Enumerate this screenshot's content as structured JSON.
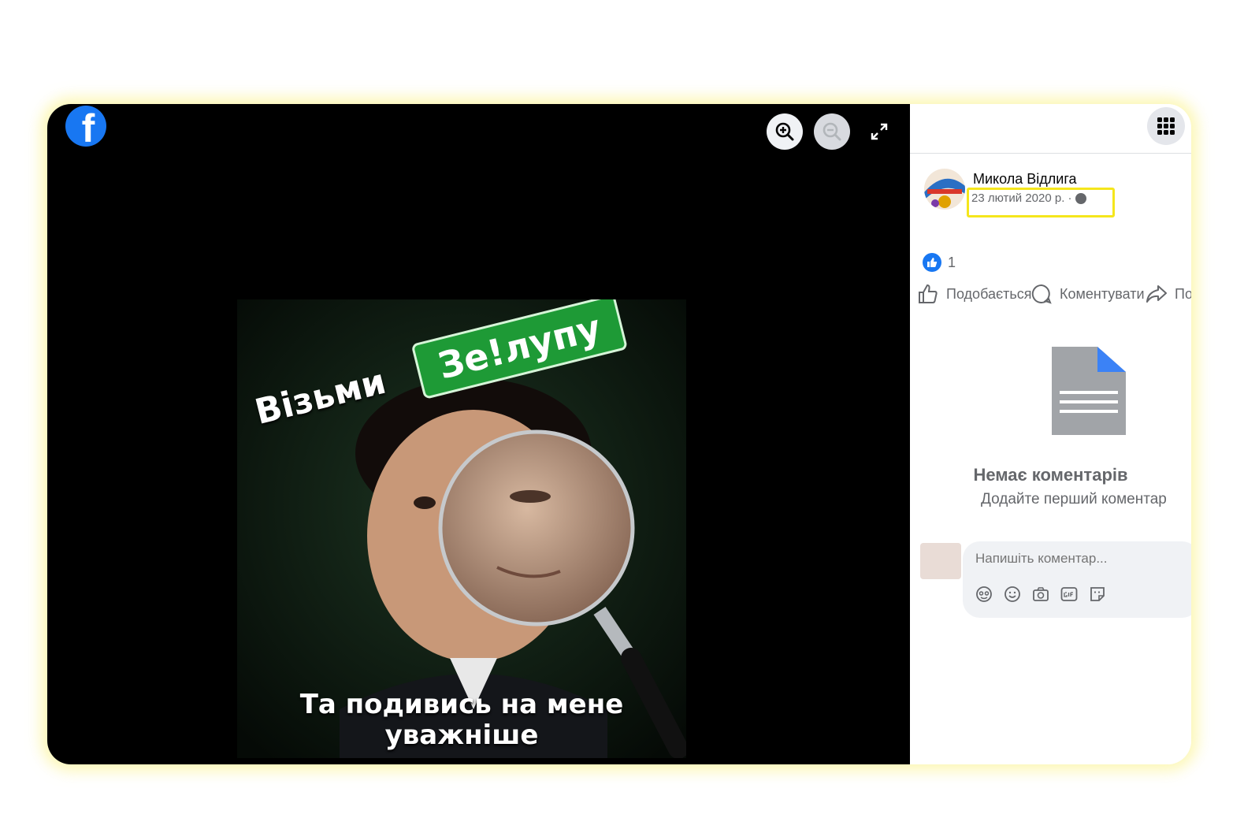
{
  "viewer": {
    "zoom_in_icon": "zoom-in-icon",
    "zoom_out_icon": "zoom-out-icon",
    "fullscreen_icon": "fullscreen-icon",
    "logo": "f"
  },
  "image": {
    "top_text": "Візьми",
    "badge_text": "Зе!лупу",
    "bottom_line1": "Та подивись на мене",
    "bottom_line2": "уважніше"
  },
  "post": {
    "author": "Микола Відлига",
    "date": "23 лютий 2020 р. ·",
    "like_count": "1"
  },
  "actions": {
    "like": "Подобається",
    "comment": "Коментувати",
    "share": "По"
  },
  "comments": {
    "empty_title": "Немає коментарів",
    "empty_subtitle": "Додайте перший коментар",
    "placeholder": "Напишіть коментар..."
  },
  "colors": {
    "brand": "#1877f2",
    "highlight": "#f5e61c",
    "badge_green": "#1e9a36"
  }
}
